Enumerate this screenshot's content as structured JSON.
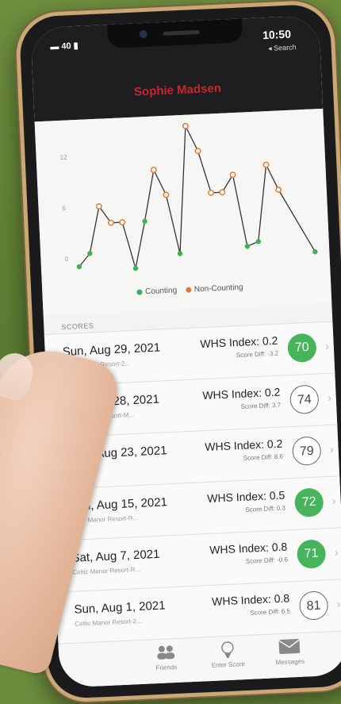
{
  "status": {
    "time": "10:50",
    "back_label": "◂ Search",
    "left": "40"
  },
  "nav": {
    "title": "Sophie Madsen"
  },
  "chart_data": {
    "type": "line",
    "x": [
      1,
      2,
      3,
      4,
      5,
      6,
      7,
      8,
      9,
      10,
      11,
      12,
      13,
      14,
      15,
      16,
      17,
      18,
      19,
      20,
      21,
      22
    ],
    "yticks": [
      0,
      6,
      12
    ],
    "ylim": [
      -1,
      15
    ],
    "series": [
      {
        "name": "Counting",
        "color": "#3fb057",
        "points": [
          [
            1,
            -1
          ],
          [
            2,
            0.5
          ],
          [
            6,
            -1.5
          ],
          [
            7,
            4
          ],
          [
            10,
            0
          ],
          [
            16,
            0.5
          ],
          [
            17,
            1
          ],
          [
            22,
            -0.5
          ]
        ]
      },
      {
        "name": "Non-Counting",
        "color": "#e07a3a",
        "points": [
          [
            3,
            6
          ],
          [
            4,
            4
          ],
          [
            5,
            4
          ],
          [
            8,
            10
          ],
          [
            9,
            7
          ],
          [
            11,
            15
          ],
          [
            12,
            12
          ],
          [
            13,
            7
          ],
          [
            14,
            7
          ],
          [
            15,
            9
          ],
          [
            18,
            10
          ],
          [
            19,
            7
          ]
        ]
      }
    ],
    "line_order": [
      1,
      2,
      3,
      4,
      5,
      6,
      7,
      8,
      9,
      10,
      11,
      12,
      13,
      14,
      15,
      16,
      17,
      18,
      19,
      20,
      21,
      22
    ],
    "values_all": [
      -1,
      0.5,
      6,
      4,
      4,
      -1.5,
      4,
      10,
      7,
      0,
      15,
      12,
      7,
      7,
      9,
      0.5,
      1,
      10,
      7,
      -0.5
    ]
  },
  "legend": {
    "counting": "Counting",
    "noncounting": "Non-Counting"
  },
  "scores_header": "SCORES",
  "rounds": [
    {
      "date": "Sun, Aug 29, 2021",
      "course": "Celtic Manor Resort-2...",
      "whs": "WHS Index: 0.2",
      "diff": "Score Diff: -3.2",
      "score": "70",
      "counting": true
    },
    {
      "date": "Sat, Aug 28, 2021",
      "course": "Celtic Manor Resort-M...",
      "whs": "WHS Index: 0.2",
      "diff": "Score Diff: 3.7",
      "score": "74",
      "counting": false
    },
    {
      "date": "Mon, Aug 23, 2021",
      "course": "Llanwern",
      "whs": "WHS Index: 0.2",
      "diff": "Score Diff: 8.6",
      "score": "79",
      "counting": false
    },
    {
      "date": "Sun, Aug 15, 2021",
      "course": "Celtic Manor Resort-R...",
      "whs": "WHS Index: 0.5",
      "diff": "Score Diff: 0.3",
      "score": "72",
      "counting": true
    },
    {
      "date": "Sat, Aug 7, 2021",
      "course": "Celtic Manor Resort-R...",
      "whs": "WHS Index: 0.8",
      "diff": "Score Diff: -0.6",
      "score": "71",
      "counting": true
    },
    {
      "date": "Sun, Aug 1, 2021",
      "course": "Celtic Manor Resort-2...",
      "whs": "WHS Index: 0.8",
      "diff": "Score Diff: 6.5",
      "score": "81",
      "counting": false
    }
  ],
  "tabs": [
    {
      "label": "Friends",
      "icon": "friends-icon"
    },
    {
      "label": "Enter Score",
      "icon": "golf-ball-tee-icon"
    },
    {
      "label": "Messages",
      "icon": "envelope-icon"
    }
  ],
  "colors": {
    "accent": "#c8262f",
    "counting": "#45b45a",
    "noncounting": "#e07a3a"
  }
}
